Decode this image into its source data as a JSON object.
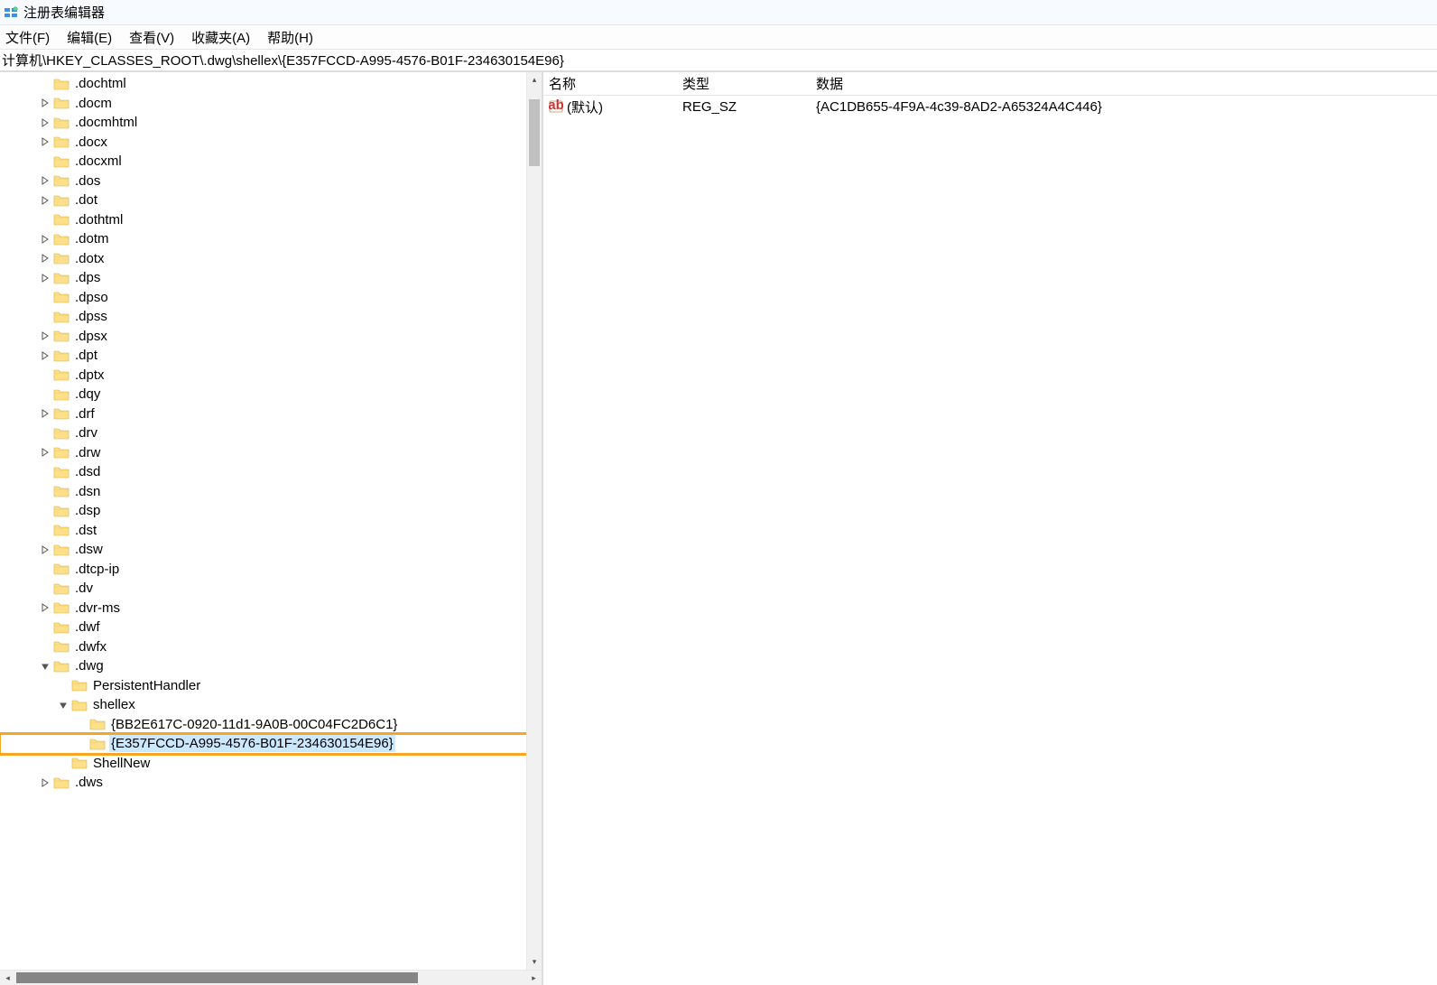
{
  "window": {
    "title": "注册表编辑器"
  },
  "menu": {
    "file": "文件(F)",
    "edit": "编辑(E)",
    "view": "查看(V)",
    "fav": "收藏夹(A)",
    "help": "帮助(H)"
  },
  "address": "计算机\\HKEY_CLASSES_ROOT\\.dwg\\shellex\\{E357FCCD-A995-4576-B01F-234630154E96}",
  "tree": [
    {
      "depth": 3,
      "exp": "none",
      "label": ".dochtml"
    },
    {
      "depth": 3,
      "exp": "closed",
      "label": ".docm"
    },
    {
      "depth": 3,
      "exp": "closed",
      "label": ".docmhtml"
    },
    {
      "depth": 3,
      "exp": "closed",
      "label": ".docx"
    },
    {
      "depth": 3,
      "exp": "none",
      "label": ".docxml"
    },
    {
      "depth": 3,
      "exp": "closed",
      "label": ".dos"
    },
    {
      "depth": 3,
      "exp": "closed",
      "label": ".dot"
    },
    {
      "depth": 3,
      "exp": "none",
      "label": ".dothtml"
    },
    {
      "depth": 3,
      "exp": "closed",
      "label": ".dotm"
    },
    {
      "depth": 3,
      "exp": "closed",
      "label": ".dotx"
    },
    {
      "depth": 3,
      "exp": "closed",
      "label": ".dps"
    },
    {
      "depth": 3,
      "exp": "none",
      "label": ".dpso"
    },
    {
      "depth": 3,
      "exp": "none",
      "label": ".dpss"
    },
    {
      "depth": 3,
      "exp": "closed",
      "label": ".dpsx"
    },
    {
      "depth": 3,
      "exp": "closed",
      "label": ".dpt"
    },
    {
      "depth": 3,
      "exp": "none",
      "label": ".dptx"
    },
    {
      "depth": 3,
      "exp": "none",
      "label": ".dqy"
    },
    {
      "depth": 3,
      "exp": "closed",
      "label": ".drf"
    },
    {
      "depth": 3,
      "exp": "none",
      "label": ".drv"
    },
    {
      "depth": 3,
      "exp": "closed",
      "label": ".drw"
    },
    {
      "depth": 3,
      "exp": "none",
      "label": ".dsd"
    },
    {
      "depth": 3,
      "exp": "none",
      "label": ".dsn"
    },
    {
      "depth": 3,
      "exp": "none",
      "label": ".dsp"
    },
    {
      "depth": 3,
      "exp": "none",
      "label": ".dst"
    },
    {
      "depth": 3,
      "exp": "closed",
      "label": ".dsw"
    },
    {
      "depth": 3,
      "exp": "none",
      "label": ".dtcp-ip"
    },
    {
      "depth": 3,
      "exp": "none",
      "label": ".dv"
    },
    {
      "depth": 3,
      "exp": "closed",
      "label": ".dvr-ms"
    },
    {
      "depth": 3,
      "exp": "none",
      "label": ".dwf"
    },
    {
      "depth": 3,
      "exp": "none",
      "label": ".dwfx"
    },
    {
      "depth": 3,
      "exp": "open",
      "label": ".dwg"
    },
    {
      "depth": 4,
      "exp": "none",
      "label": "PersistentHandler"
    },
    {
      "depth": 4,
      "exp": "open",
      "label": "shellex"
    },
    {
      "depth": 5,
      "exp": "none",
      "label": "{BB2E617C-0920-11d1-9A0B-00C04FC2D6C1}"
    },
    {
      "depth": 5,
      "exp": "none",
      "label": "{E357FCCD-A995-4576-B01F-234630154E96}",
      "selected": true,
      "highlight": true
    },
    {
      "depth": 4,
      "exp": "none",
      "label": "ShellNew"
    },
    {
      "depth": 3,
      "exp": "closed",
      "label": ".dws"
    }
  ],
  "list": {
    "headers": {
      "name": "名称",
      "type": "类型",
      "data": "数据"
    },
    "rows": [
      {
        "name": "(默认)",
        "type": "REG_SZ",
        "data": "{AC1DB655-4F9A-4c39-8AD2-A65324A4C446}"
      }
    ]
  }
}
